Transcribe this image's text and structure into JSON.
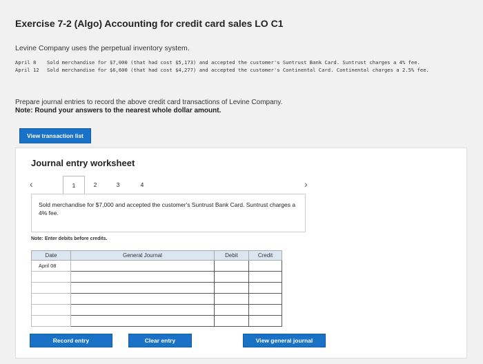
{
  "header": {
    "title": "Exercise 7-2 (Algo) Accounting for credit card sales LO C1"
  },
  "intro": "Levine Company uses the perpetual inventory system.",
  "transactions": [
    {
      "date": "April  8",
      "text": "Sold merchandise for $7,000 (that had cost $5,173) and accepted the customer's Suntrust Bank Card. Suntrust charges a 4% fee."
    },
    {
      "date": "April 12",
      "text": "Sold merchandise for $6,600 (that had cost $4,277) and accepted the customer's Continental Card. Continental charges a 2.5% fee."
    }
  ],
  "prompt": "Prepare journal entries to record the above credit card transactions of Levine Company.",
  "note": "Note: Round your answers to the nearest whole dollar amount.",
  "buttons": {
    "view_transactions": "View transaction list",
    "record_entry": "Record entry",
    "clear_entry": "Clear entry",
    "view_general_journal": "View general journal"
  },
  "worksheet": {
    "title": "Journal entry worksheet",
    "pages": [
      "1",
      "2",
      "3",
      "4"
    ],
    "active_page": "1",
    "description": "Sold merchandise for $7,000 and accepted the customer's Suntrust Bank Card. Suntrust charges a 4% fee.",
    "enter_note": "Note: Enter debits before credits.",
    "columns": {
      "date": "Date",
      "account": "General Journal",
      "debit": "Debit",
      "credit": "Credit"
    },
    "rows": [
      {
        "date": "April 08",
        "account": "",
        "debit": "",
        "credit": ""
      },
      {
        "date": "",
        "account": "",
        "debit": "",
        "credit": ""
      },
      {
        "date": "",
        "account": "",
        "debit": "",
        "credit": ""
      },
      {
        "date": "",
        "account": "",
        "debit": "",
        "credit": ""
      },
      {
        "date": "",
        "account": "",
        "debit": "",
        "credit": ""
      },
      {
        "date": "",
        "account": "",
        "debit": "",
        "credit": ""
      }
    ]
  },
  "colors": {
    "accent": "#1a72c7",
    "table_header": "#dce6f2"
  }
}
